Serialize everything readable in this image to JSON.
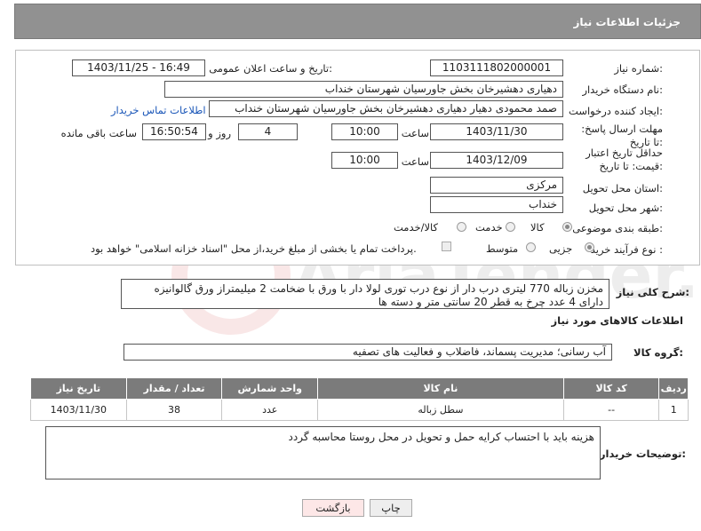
{
  "header_title": "جزئیات اطلاعات نیاز",
  "fields": {
    "need_number_label": "شماره نیاز:",
    "need_number": "1103111802000001",
    "announce_label": "تاریخ و ساعت اعلان عمومی:",
    "announce_value": "1403/11/25 - 16:49",
    "buyer_org_label": "نام دستگاه خریدار:",
    "buyer_org": "دهیاری دهشیرخان بخش جاورسیان شهرستان خنداب",
    "creator_label": "ایجاد کننده درخواست:",
    "creator": "صمد محمودی دهیار دهیاری دهشیرخان بخش جاورسیان شهرستان خنداب",
    "contact_link": "اطلاعات تماس خریدار",
    "reply_deadline_label": "مهلت ارسال پاسخ: تا تاریخ:",
    "reply_date": "1403/11/30",
    "time_label": "ساعت",
    "reply_time": "10:00",
    "days_value": "4",
    "days_label": "روز و",
    "remaining_time": "16:50:54",
    "remaining_label": "ساعت باقی مانده",
    "validity_label": "حداقل تاریخ اعتبار قیمت: تا تاریخ:",
    "validity_date": "1403/12/09",
    "validity_time": "10:00",
    "province_label": "استان محل تحویل:",
    "province": "مرکزی",
    "city_label": "شهر محل تحویل:",
    "city": "خنداب",
    "category_label": "طبقه بندی موضوعی:",
    "category_options": [
      "کالا",
      "خدمت",
      "کالا/خدمت"
    ],
    "process_label": "نوع فرآیند خرید :",
    "process_options": [
      "جزیی",
      "متوسط"
    ],
    "payment_text": "پرداخت تمام یا بخشی از مبلغ خرید،از محل \"اسناد خزانه اسلامی\" خواهد بود."
  },
  "description": {
    "label": "شرح کلی نیاز:",
    "text": "مخزن زباله 770 لیتری درب دار از نوع درب توری لولا دار با ورق با ضخامت 2 میلیمتراز ورق گالوانیزه دارای 4 عدد چرخ به قطر 20 سانتی متر و دسته ها"
  },
  "goods_info_title": "اطلاعات کالاهای مورد نیاز",
  "goods_group": {
    "label": "گروه کالا:",
    "value": "آب رسانی؛ مدیریت پسماند، فاضلاب و فعالیت های تصفیه"
  },
  "table": {
    "headers": [
      "ردیف",
      "کد کالا",
      "نام کالا",
      "واحد شمارش",
      "تعداد / مقدار",
      "تاریخ نیاز"
    ],
    "rows": [
      [
        "1",
        "--",
        "سطل زباله",
        "عدد",
        "38",
        "1403/11/30"
      ]
    ]
  },
  "buyer_notes": {
    "label": "توضیحات خریدار:",
    "text": "هزینه باید با احتساب کرایه حمل و تحویل در محل روستا محاسبه گردد"
  },
  "buttons": {
    "print": "چاپ",
    "back": "بازگشت"
  },
  "watermark_text": "AriaTender.neT"
}
